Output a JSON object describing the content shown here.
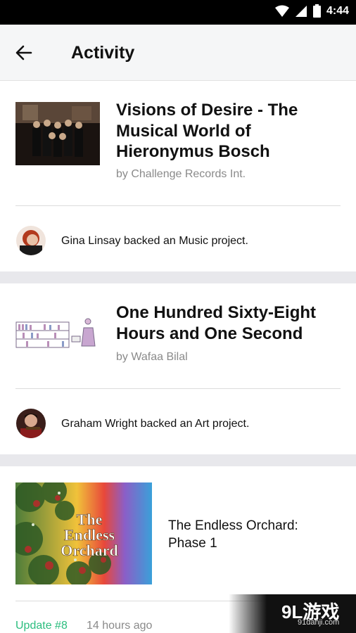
{
  "status_bar": {
    "time": "4:44"
  },
  "app_bar": {
    "title": "Activity"
  },
  "items": [
    {
      "project_title": "Visions of Desire - The Musical World of Hieronymus Bosch",
      "creator": "by Challenge Records Int.",
      "backer_text": "Gina Linsay backed an Music project."
    },
    {
      "project_title": "One Hundred Sixty-Eight Hours and One Second",
      "creator": "by Wafaa Bilal",
      "backer_text": "Graham Wright backed an Art project."
    }
  ],
  "update_item": {
    "project_title": "The Endless Orchard: Phase 1",
    "thumbnail_text": "The Endless Orchard",
    "update_label": "Update #8",
    "time_ago": "14 hours ago"
  },
  "watermark": {
    "brand": "9L游戏",
    "site": "91danji.com"
  }
}
